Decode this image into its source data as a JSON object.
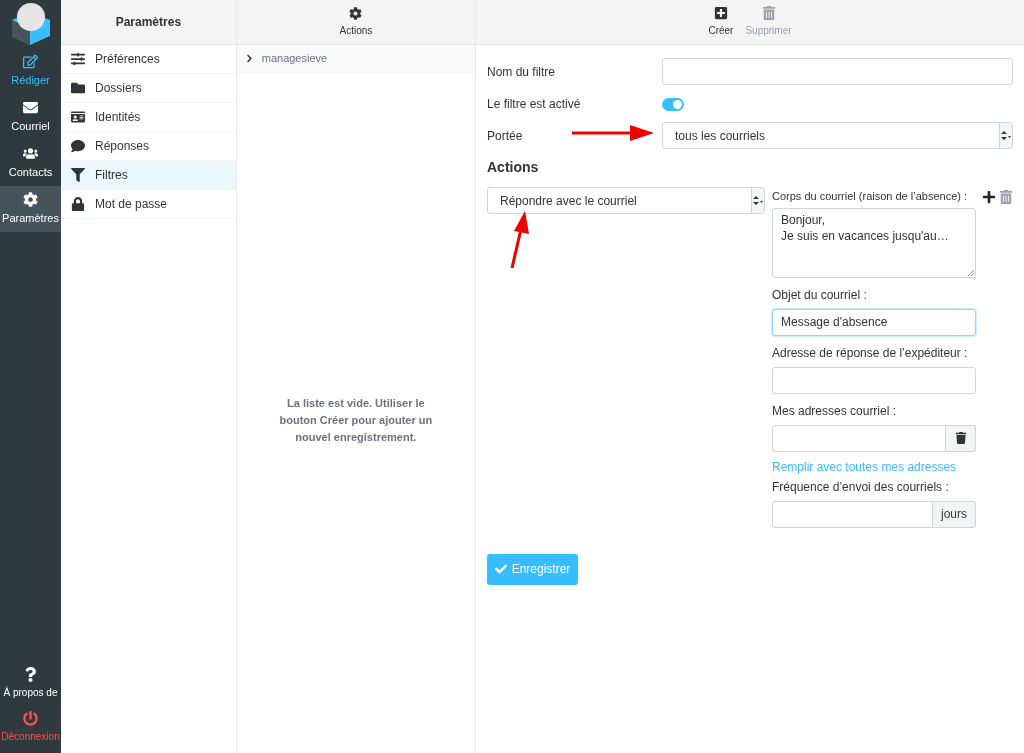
{
  "nav": {
    "items": [
      {
        "label": "Rédiger",
        "kind": "compose",
        "selected": false,
        "highlight": true
      },
      {
        "label": "Courriel",
        "kind": "mail",
        "selected": false,
        "highlight": false
      },
      {
        "label": "Contacts",
        "kind": "contacts",
        "selected": false,
        "highlight": false
      },
      {
        "label": "Paramètres",
        "kind": "settings",
        "selected": true,
        "highlight": false
      }
    ],
    "bottom": [
      {
        "label": "À propos de",
        "kind": "about"
      },
      {
        "label": "Déconnexion",
        "kind": "logout"
      }
    ]
  },
  "settings": {
    "title": "Paramètres",
    "items": [
      {
        "label": "Préférences",
        "kind": "sliders",
        "selected": false
      },
      {
        "label": "Dossiers",
        "kind": "folder",
        "selected": false
      },
      {
        "label": "Identités",
        "kind": "id",
        "selected": false
      },
      {
        "label": "Réponses",
        "kind": "comment",
        "selected": false
      },
      {
        "label": "Filtres",
        "kind": "filter",
        "selected": true
      },
      {
        "label": "Mot de passe",
        "kind": "lock",
        "selected": false
      }
    ]
  },
  "filters": {
    "toolbar_label": "Actions",
    "sets": [
      {
        "label": "managesieve",
        "expanded": false
      }
    ],
    "empty_message": "La liste est vide. Utiliser le bouton Créer pour ajouter un nouvel enregistrement."
  },
  "editor": {
    "toolbar": [
      {
        "label": "Créer",
        "kind": "create",
        "disabled": false
      },
      {
        "label": "Supprimer",
        "kind": "delete",
        "disabled": true
      }
    ],
    "name_label": "Nom du filtre",
    "enabled_label": "Le filtre est activé",
    "enabled": true,
    "scope_label": "Portée",
    "scope": "tous les courriels",
    "actions_title": "Actions",
    "action": "Répondre avec le courriel",
    "body_label": "Corps du courriel (raison de l’absence) :",
    "body_lines": [
      "Bonjour,",
      "Je suis en vacances jusqu'au…"
    ],
    "subject_label": "Objet du courriel :",
    "subject": "Message d'absence",
    "reply_label": "Adresse de réponse de l’expéditeur :",
    "addresses_label": "Mes adresses courriel :",
    "fill_link": "Remplir avec toutes mes adresses",
    "frequency_label": "Fréquence d’envoi des courriels :",
    "frequency_unit": "jours",
    "save": "Enregistrer"
  }
}
